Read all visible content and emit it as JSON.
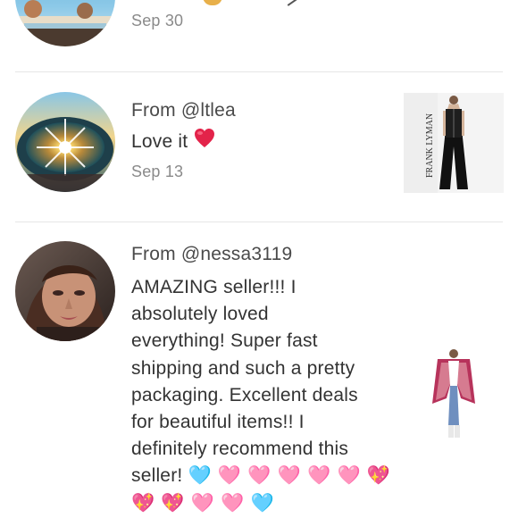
{
  "reviews": [
    {
      "date": "Sep 30"
    },
    {
      "from": "From @ltlea",
      "text": "Love it",
      "date": "Sep 13"
    },
    {
      "from": "From @nessa3119",
      "lines": [
        "AMAZING seller!!! I",
        "absolutely loved",
        "everything! Super fast",
        "shipping and such a pretty",
        "packaging. Excellent deals",
        "for beautiful items!! I",
        "definitely recommend this",
        "seller!"
      ]
    }
  ],
  "emoji": {
    "red_heart": "❤️",
    "blue_heart": "🩵",
    "pink_heart": "🩷",
    "sparkling_heart": "💖",
    "heart_decoration": "💗"
  },
  "thumb_brand_text": "FRANK LYMAN"
}
